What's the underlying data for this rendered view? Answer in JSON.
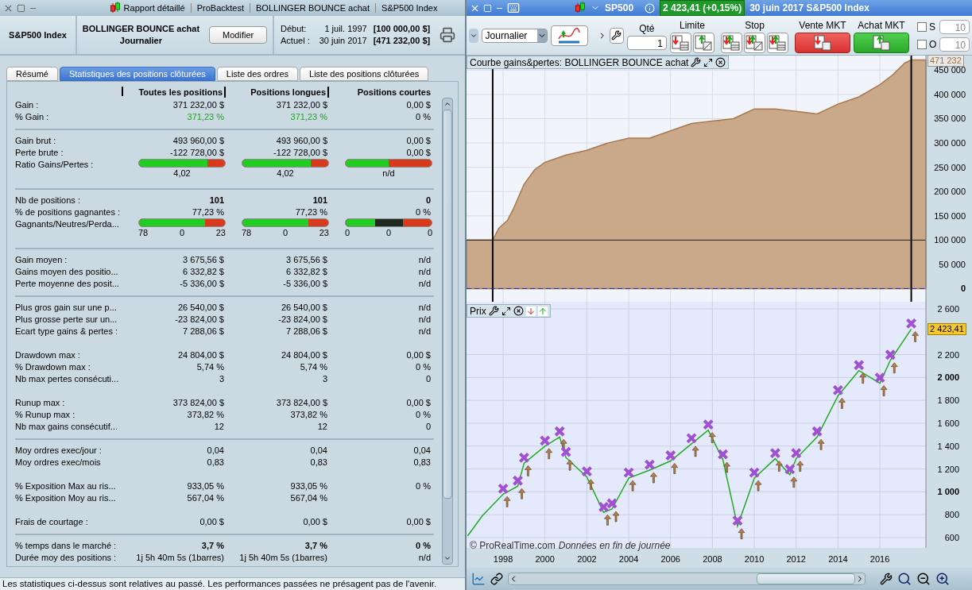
{
  "report": {
    "title_parts": [
      "Rapport détaillé",
      "ProBacktest",
      "BOLLINGER BOUNCE achat",
      "S&P500 Index"
    ],
    "instrument": "S&P500 Index",
    "strategy": "BOLLINGER BOUNCE achat",
    "timeframe": "Journalier",
    "edit_button": "Modifier",
    "start": {
      "label": "Début:",
      "date": "1 juil. 1997",
      "capital": "[100 000,00 $]"
    },
    "current": {
      "label": "Actuel :",
      "date": "30 juin 2017",
      "capital": "[471 232,00 $]"
    },
    "tabs": [
      {
        "label": "Résumé",
        "selected": false
      },
      {
        "label": "Statistiques des positions clôturées",
        "selected": true
      },
      {
        "label": "Liste des ordres",
        "selected": false
      },
      {
        "label": "Liste des positions clôturées",
        "selected": false
      }
    ],
    "columns": [
      "Toutes les positions",
      "Positions longues",
      "Positions courtes"
    ],
    "sections": [
      {
        "divider": true,
        "rows": [
          {
            "kind": "text",
            "label": "Gain :",
            "values": [
              "371 232,00 $",
              "371 232,00 $",
              "0,00 $"
            ]
          },
          {
            "kind": "text",
            "label": "% Gain :",
            "values": [
              {
                "text": "371,23 %",
                "color": "#1ea51e"
              },
              {
                "text": "371,23 %",
                "color": "#1ea51e"
              },
              "0 %"
            ]
          }
        ]
      },
      {
        "divider": true,
        "rows": [
          {
            "kind": "text",
            "label": "Gain brut :",
            "values": [
              "493 960,00 $",
              "493 960,00 $",
              "0,00 $"
            ]
          },
          {
            "kind": "text",
            "label": "Perte brute :",
            "values": [
              "-122 728,00 $",
              "-122 728,00 $",
              "0,00 $"
            ]
          },
          {
            "kind": "bar",
            "label": "Ratio Gains/Pertes :",
            "bars": [
              {
                "color": "#d83a1e",
                "segments": [
                  {
                    "color": "#22cc22",
                    "level": 0.8
                  }
                ],
                "captions": [
                  "4,02"
                ]
              },
              {
                "color": "#d83a1e",
                "segments": [
                  {
                    "color": "#22cc22",
                    "level": 0.8
                  }
                ],
                "captions": [
                  "4,02"
                ]
              },
              {
                "color": "#d83a1e",
                "segments": [
                  {
                    "color": "#22cc22",
                    "level": 0.5
                  }
                ],
                "captions": [
                  "n/d"
                ]
              }
            ]
          }
        ]
      },
      {
        "divider": true,
        "rows": [
          {
            "kind": "text",
            "label": "Nb de positions :",
            "bold": true,
            "values": [
              "101",
              "101",
              "0"
            ]
          },
          {
            "kind": "text",
            "label": "% de positions gagnantes :",
            "values": [
              "77,23 %",
              "77,23 %",
              "0 %"
            ]
          },
          {
            "kind": "bar",
            "label": "Gagnants/Neutres/Perda...",
            "bars": [
              {
                "color": "#d83a1e",
                "segments": [
                  {
                    "color": "#22cc22",
                    "level": 0.77
                  }
                ],
                "captions": [
                  "78",
                  "0",
                  "23"
                ]
              },
              {
                "color": "#d83a1e",
                "segments": [
                  {
                    "color": "#22cc22",
                    "level": 0.77
                  }
                ],
                "captions": [
                  "78",
                  "0",
                  "23"
                ]
              },
              {
                "color": "#d83a1e",
                "segments": [
                  {
                    "color": "#22cc22",
                    "level": 0.34
                  },
                  {
                    "color": "#1e2a1e",
                    "level": 0.67
                  }
                ],
                "captions": [
                  "0",
                  "0",
                  "0"
                ]
              }
            ]
          }
        ]
      },
      {
        "divider": true,
        "rows": [
          {
            "kind": "text",
            "label": "Gain moyen :",
            "values": [
              "3 675,56 $",
              "3 675,56 $",
              "n/d"
            ]
          },
          {
            "kind": "text",
            "label": "Gains moyen des positio...",
            "values": [
              "6 332,82 $",
              "6 332,82 $",
              "n/d"
            ]
          },
          {
            "kind": "text",
            "label": "Perte moyenne des posit...",
            "values": [
              "-5 336,00 $",
              "-5 336,00 $",
              "n/d"
            ]
          }
        ]
      },
      {
        "divider": false,
        "rows": [
          {
            "kind": "text",
            "label": "Plus gros gain sur une p...",
            "values": [
              "26 540,00 $",
              "26 540,00 $",
              "n/d"
            ]
          },
          {
            "kind": "text",
            "label": "Plus grosse perte sur un...",
            "values": [
              "-23 824,00 $",
              "-23 824,00 $",
              "n/d"
            ]
          },
          {
            "kind": "text",
            "label": "Ecart type gains & pertes :",
            "values": [
              "7 288,06 $",
              "7 288,06 $",
              "n/d"
            ]
          }
        ]
      },
      {
        "divider": false,
        "rows": [
          {
            "kind": "text",
            "label": "Drawdown max :",
            "values": [
              "24 804,00 $",
              "24 804,00 $",
              "0,00 $"
            ]
          },
          {
            "kind": "text",
            "label": "% Drawdown max :",
            "values": [
              "5,74 %",
              "5,74 %",
              "0 %"
            ]
          },
          {
            "kind": "text",
            "label": "Nb max pertes consécuti...",
            "values": [
              "3",
              "3",
              "0"
            ]
          }
        ]
      },
      {
        "divider": true,
        "rows": [
          {
            "kind": "text",
            "label": "Runup max :",
            "values": [
              "373 824,00 $",
              "373 824,00 $",
              "0,00 $"
            ]
          },
          {
            "kind": "text",
            "label": "% Runup max :",
            "values": [
              "373,82 %",
              "373,82 %",
              "0 %"
            ]
          },
          {
            "kind": "text",
            "label": "Nb max gains consécutif...",
            "values": [
              "12",
              "12",
              "0"
            ]
          }
        ]
      },
      {
        "divider": false,
        "rows": [
          {
            "kind": "text",
            "label": "Moy ordres exec/jour :",
            "values": [
              "0,04",
              "0,04",
              "0,04"
            ]
          },
          {
            "kind": "text",
            "label": "Moy ordres exec/mois",
            "values": [
              "0,83",
              "0,83",
              "0,83"
            ]
          }
        ]
      },
      {
        "divider": false,
        "rows": [
          {
            "kind": "text",
            "label": "% Exposition Max au ris...",
            "values": [
              "933,05 %",
              "933,05 %",
              "0 %"
            ]
          },
          {
            "kind": "text",
            "label": "% Exposition Moy au ris...",
            "values": [
              "567,04 %",
              "567,04 %"
            ]
          }
        ]
      },
      {
        "divider": true,
        "rows": [
          {
            "kind": "text",
            "label": "Frais de courtage :",
            "values": [
              "0,00 $",
              "0,00 $",
              "0,00 $"
            ]
          }
        ]
      },
      {
        "rows": [
          {
            "kind": "text",
            "label": "% temps dans le marché :",
            "bold": true,
            "values": [
              "3,7 %",
              "3,7 %",
              "0 %"
            ]
          },
          {
            "kind": "text",
            "label": "Durée moy des positions :",
            "values": [
              "1j 5h 40m 5s (1barres)",
              "1j 5h 40m 5s (1barres)",
              "n/d"
            ]
          }
        ]
      }
    ],
    "footer": "Les statistiques ci-dessus sont relatives au passé. Les performances passées ne présagent pas de l'avenir."
  },
  "chart_window": {
    "symbol": "SP500",
    "quote": "2 423,41 (+0,15%)",
    "date_title": "30 juin 2017 S&P500 Index",
    "timeframe": "Journalier",
    "quantity": {
      "label": "Qté",
      "value": "1"
    },
    "limit_label": "Limite",
    "stop_label": "Stop",
    "sell_label": "Vente MKT",
    "buy_label": "Achat MKT",
    "side_fields": [
      {
        "label": "S",
        "value": "10",
        "checked": false,
        "disabled": true
      },
      {
        "label": "O",
        "value": "10",
        "checked": false,
        "disabled": true
      }
    ],
    "equity_panel": {
      "title": "Courbe gains&pertes: BOLLINGER BOUNCE achat",
      "last_value": "471 232",
      "chart_data": {
        "type": "area",
        "grid": true,
        "xlim": [
          1996.25,
          2018.2
        ],
        "ylim": [
          -27000,
          480000
        ],
        "ref_lines": [
          {
            "axis": "x",
            "value": 1997.5,
            "color": "#000000"
          },
          {
            "axis": "x",
            "value": 2017.5,
            "color": "#000000"
          },
          {
            "axis": "y",
            "value": 0,
            "color": "#2233cc"
          },
          {
            "axis": "y",
            "value": 100000,
            "color": "#222222"
          }
        ],
        "yticks": [
          {
            "value": 0,
            "label": "0"
          },
          {
            "value": 50000,
            "label": "50 000"
          },
          {
            "value": 100000,
            "label": "100 000"
          },
          {
            "value": 150000,
            "label": "150 000"
          },
          {
            "value": 200000,
            "label": "200 000"
          },
          {
            "value": 250000,
            "label": "250 000"
          },
          {
            "value": 300000,
            "label": "300 000"
          },
          {
            "value": 350000,
            "label": "350 000"
          },
          {
            "value": 400000,
            "label": "400 000"
          },
          {
            "value": 450000,
            "label": "450 000"
          }
        ],
        "x": [
          1996.25,
          1997.5,
          1997.8,
          1998.2,
          1998.5,
          1999,
          1999.5,
          2000,
          2001,
          2002,
          2003,
          2004,
          2005,
          2006,
          2007,
          2008,
          2009,
          2010,
          2011,
          2012,
          2013,
          2014,
          2015,
          2016,
          2016.6,
          2017.2,
          2017.5,
          2018.2
        ],
        "series": [
          {
            "color": "#a8784a",
            "values": [
              100000,
              100000,
              125000,
              140000,
              165000,
              215000,
              245000,
              260000,
              275000,
              285000,
              300000,
              310000,
              310000,
              325000,
              340000,
              345000,
              350000,
              370000,
              370000,
              365000,
              360000,
              380000,
              395000,
              420000,
              440000,
              465000,
              471000,
              471000
            ]
          }
        ]
      }
    },
    "price_panel": {
      "title": "Prix",
      "last_value": "2 423,41",
      "copyright": "© ProRealTime.com",
      "data_note": "Données en fin de journée",
      "chart_data": {
        "type": "line",
        "grid": true,
        "xlim": [
          1996.25,
          2018.2
        ],
        "ylim": [
          510,
          2662
        ],
        "xticks": [
          1998,
          2000,
          2002,
          2004,
          2006,
          2008,
          2010,
          2012,
          2014,
          2016
        ],
        "yticks": [
          {
            "value": 600,
            "label": "600"
          },
          {
            "value": 800,
            "label": "800"
          },
          {
            "value": 1000,
            "label": "1 000"
          },
          {
            "value": 1200,
            "label": "1 200"
          },
          {
            "value": 1400,
            "label": "1 400"
          },
          {
            "value": 1600,
            "label": "1 600"
          },
          {
            "value": 1800,
            "label": "1 800"
          },
          {
            "value": 2000,
            "label": "2 000"
          },
          {
            "value": 2200,
            "label": "2 200"
          },
          {
            "value": 2600,
            "label": "2 600"
          }
        ],
        "x": [
          1996.3,
          1997,
          1998,
          1998.7,
          1999,
          2000,
          2000.7,
          2001,
          2002,
          2002.8,
          2003.2,
          2004,
          2005,
          2006,
          2007,
          2007.8,
          2008.5,
          2009.2,
          2010,
          2011,
          2011.7,
          2012,
          2013,
          2014,
          2015,
          2016,
          2016.5,
          2017.5
        ],
        "series": [
          {
            "color": "#22aa22",
            "values": [
              614,
              790,
              980,
              1050,
              1250,
              1400,
              1480,
              1300,
              1130,
              820,
              850,
              1120,
              1190,
              1270,
              1420,
              1540,
              1280,
              700,
              1120,
              1290,
              1150,
              1290,
              1480,
              1840,
              2060,
              1950,
              2150,
              2423
            ]
          }
        ]
      }
    }
  }
}
